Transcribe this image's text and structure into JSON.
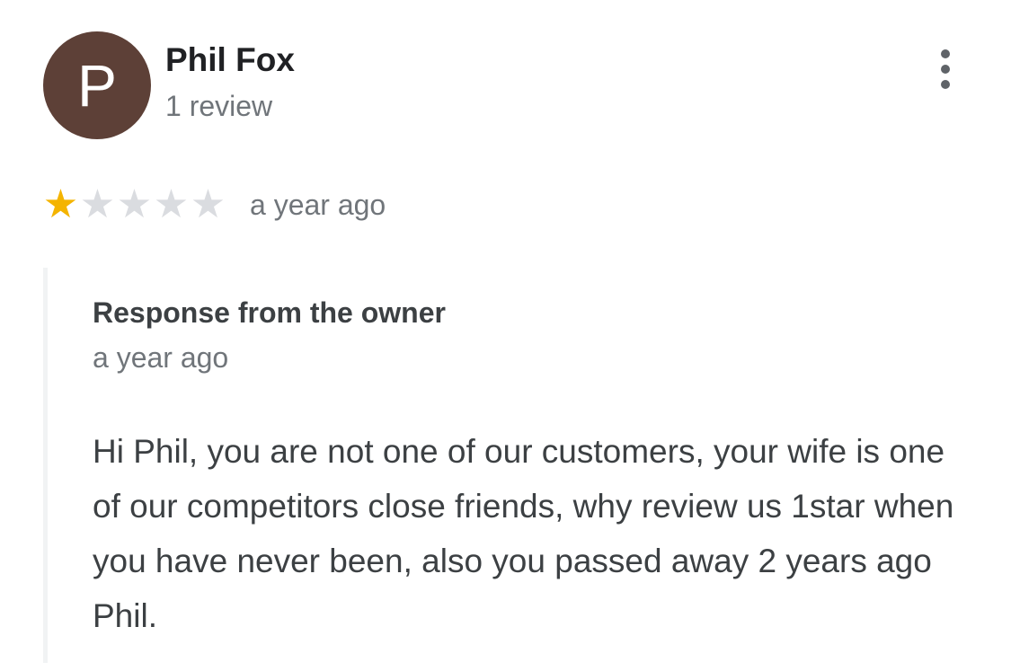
{
  "reviewer": {
    "avatar_letter": "P",
    "avatar_color": "#5d4037",
    "name": "Phil Fox",
    "review_count": "1 review"
  },
  "menu": {
    "icon": "more-vert-icon"
  },
  "rating": {
    "stars": 1,
    "max_stars": 5,
    "star_color": "#f4b400",
    "time": "a year ago"
  },
  "owner_response": {
    "title": "Response from the owner",
    "time": "a year ago",
    "text": "Hi Phil, you are not one of our customers, your wife is one of our competitors close friends, why review us 1star when you have never been, also you passed away 2 years ago Phil."
  }
}
